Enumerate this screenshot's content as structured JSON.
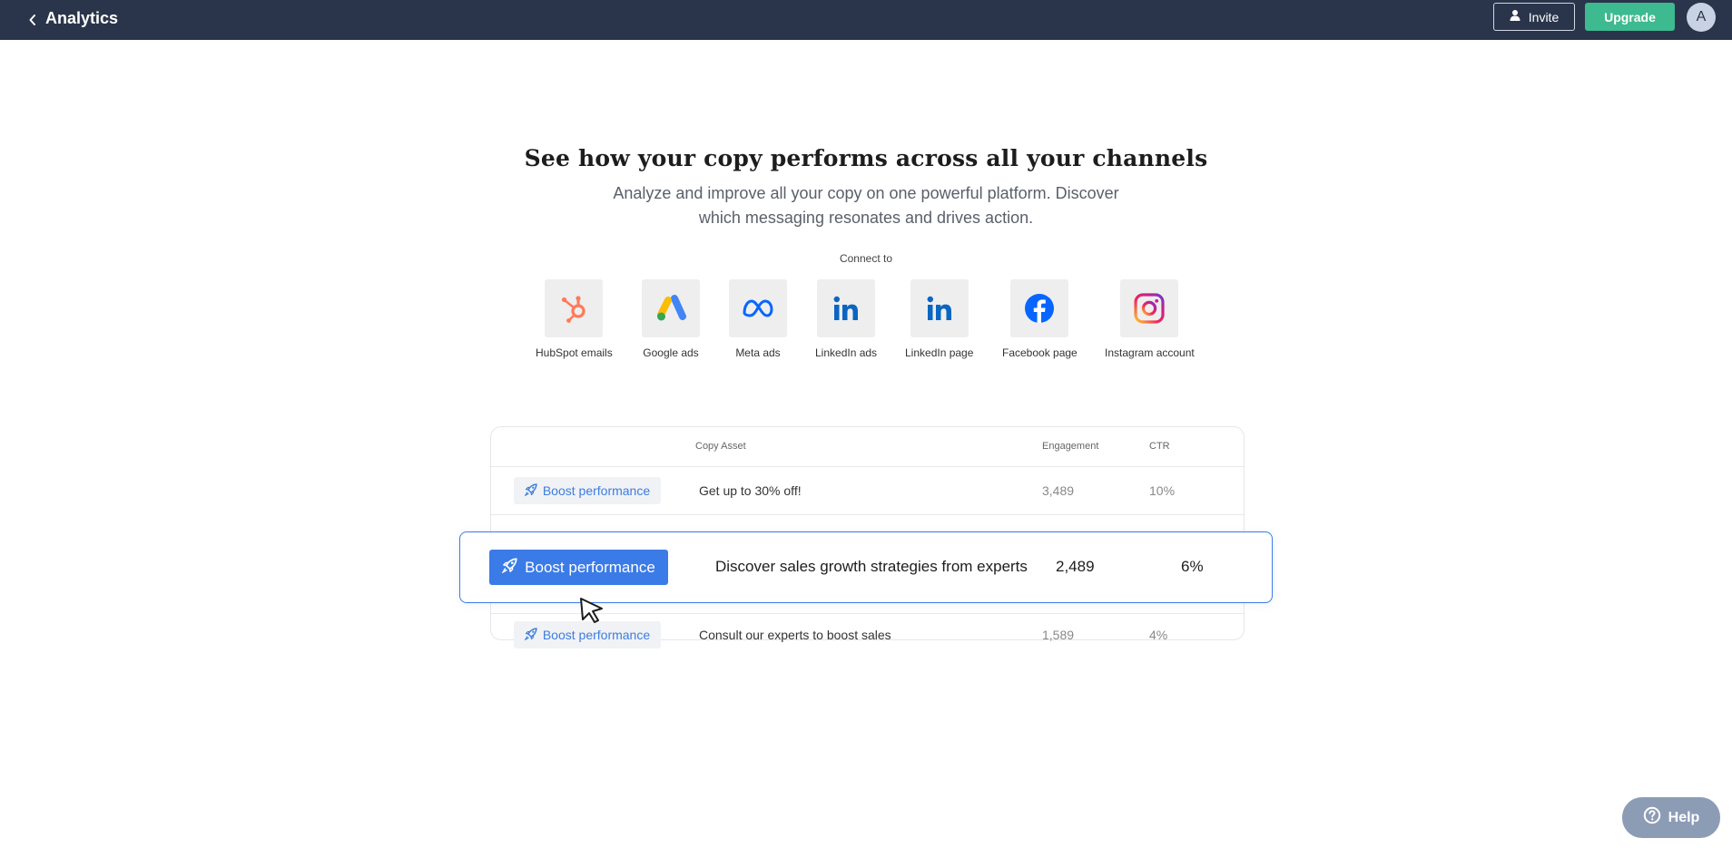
{
  "header": {
    "title": "Analytics",
    "invite_label": "Invite",
    "upgrade_label": "Upgrade",
    "avatar_initial": "A",
    "background": "#2a354b",
    "upgrade_color": "#3dba8f"
  },
  "hero": {
    "headline": "See how your copy performs across all your channels",
    "subhead": "Analyze and improve all your copy on one powerful platform. Discover which messaging resonates and drives action.",
    "connect_label": "Connect to"
  },
  "channels": [
    {
      "label": "HubSpot emails",
      "icon": "hubspot-icon"
    },
    {
      "label": "Google ads",
      "icon": "google-ads-icon"
    },
    {
      "label": "Meta ads",
      "icon": "meta-icon"
    },
    {
      "label": "LinkedIn ads",
      "icon": "linkedin-icon"
    },
    {
      "label": "LinkedIn page",
      "icon": "linkedin-icon"
    },
    {
      "label": "Facebook page",
      "icon": "facebook-icon"
    },
    {
      "label": "Instagram account",
      "icon": "instagram-icon"
    }
  ],
  "table": {
    "headers": {
      "copy_asset": "Copy Asset",
      "engagement": "Engagement",
      "ctr": "CTR"
    },
    "rows": [
      {
        "action": "Boost performance",
        "copy": "Get up to 30% off!",
        "engagement": "3,489",
        "ctr": "10%"
      },
      {
        "action": "Boost performance",
        "copy": "Discover sales growth strategies from experts",
        "engagement": "2,489",
        "ctr": "6%"
      },
      {
        "action": "Boost performance",
        "copy": "Consult our experts to boost sales",
        "engagement": "1,589",
        "ctr": "4%"
      }
    ],
    "accent": "#3b7be8"
  },
  "help": {
    "label": "Help"
  }
}
